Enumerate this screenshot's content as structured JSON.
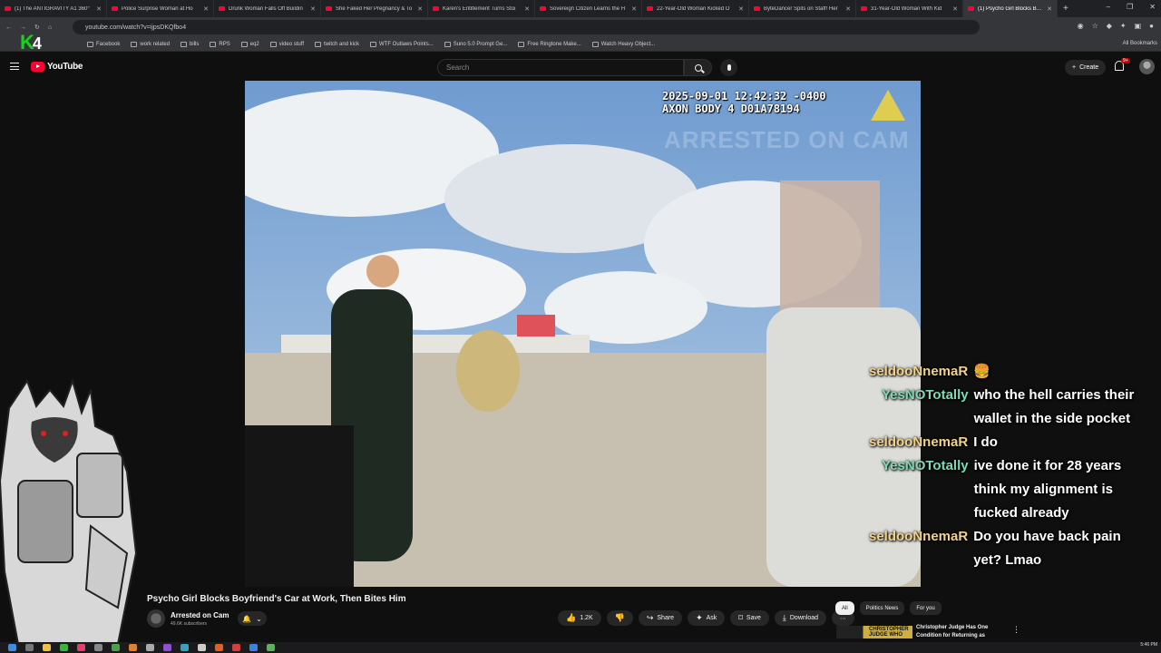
{
  "browser": {
    "tabs": [
      {
        "label": "(1) The ANTIGRAVITY A1 360°"
      },
      {
        "label": "Police Surprise Woman at Ho"
      },
      {
        "label": "Drunk Woman Falls Off Buildin"
      },
      {
        "label": "She Faked Her Pregnancy & To"
      },
      {
        "label": "Karen's Entitlement Turns Stoi"
      },
      {
        "label": "Sovereign Citizen Learns the H"
      },
      {
        "label": "22-Year-Old Woman Kicked O"
      },
      {
        "label": "ByteDancer Spits on Staff! Her"
      },
      {
        "label": "31-Year-Old Woman With Kid"
      },
      {
        "label": "(1) Psycho Girl Blocks Boyf",
        "active": true
      }
    ],
    "url": "youtube.com/watch?v=ijpsDKQfbo4",
    "bookmarks": [
      "Facebook",
      "work related",
      "bills",
      "RPS",
      "eq2",
      "video stuff",
      "twitch and kick",
      "WTF Outlaws Points...",
      "Suno 5.0 Prompt Ge...",
      "Free Ringtone Make...",
      "Watch Heavy Object..."
    ],
    "all_bookmarks": "All Bookmarks"
  },
  "overlay_logo": {
    "k": "K",
    "num": "4"
  },
  "youtube": {
    "logo_text": "YouTube",
    "search_placeholder": "Search",
    "create_label": "Create",
    "notification_count": "9+"
  },
  "video": {
    "osd_line1": "2025-09-01 12:42:32 -0400",
    "osd_line2": "AXON BODY 4 D01A78194",
    "watermark": "ARRESTED ON CAM",
    "title": "Psycho Girl Blocks Boyfriend's Car at Work, Then Bites Him",
    "channel_name": "Arrested on Cam",
    "subscribers": "49.6K subscribers",
    "likes": "1.2K",
    "actions": {
      "share": "Share",
      "ask": "Ask",
      "save": "Save",
      "download": "Download",
      "more": "⋯"
    }
  },
  "chat": [
    {
      "user": "seldooNnemaR",
      "text": "🍔",
      "color": "#f3d28a"
    },
    {
      "user": "YesNOTotally",
      "text": "who the hell carries their wallet in the side pocket",
      "color": "#7ed9b5"
    },
    {
      "user": "seldooNnemaR",
      "text": "I do",
      "color": "#f3d28a"
    },
    {
      "user": "YesNOTotally",
      "text": "ive done it for 28 years think my alignment is fucked already",
      "color": "#7ed9b5"
    },
    {
      "user": "seldooNnemaR",
      "text": "Do you have back pain yet? Lmao",
      "color": "#f3d28a"
    }
  ],
  "sidebar": {
    "chips": [
      "All",
      "Politics News",
      "For you"
    ],
    "recommendation": {
      "thumb_text": "CHRISTOPHER JUDGE WHO",
      "title": "Christopher Judge Has One Condition for Returning as"
    }
  },
  "taskbar": {
    "time": "5:46 PM"
  }
}
